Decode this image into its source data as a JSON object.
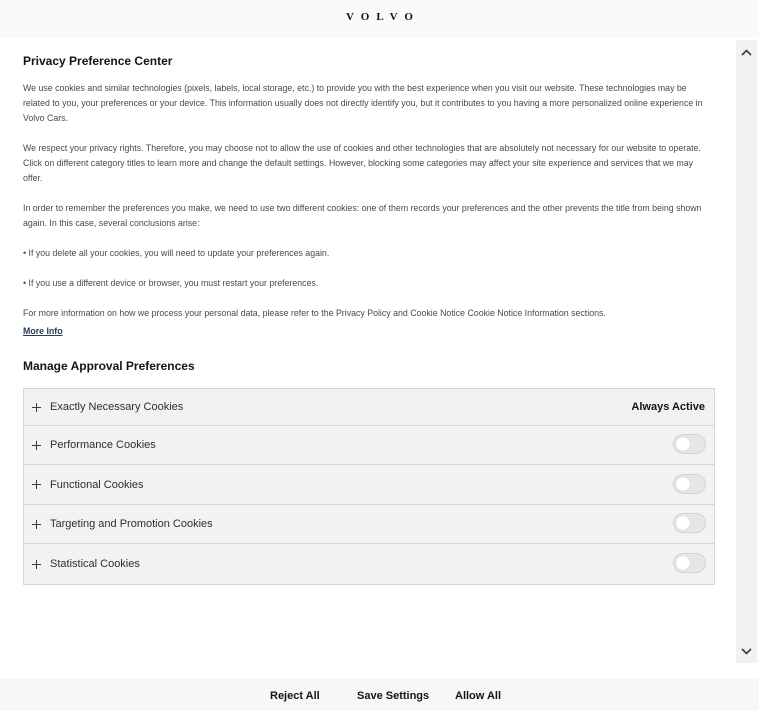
{
  "brand": {
    "logo_text": "VOLVO"
  },
  "dialog": {
    "title": "Privacy Preference Center",
    "paragraphs": [
      "We use cookies and similar technologies (pixels, labels, local storage, etc.) to provide you with the best experience when you visit our website. These technologies may be related to you, your preferences or your device. This information usually does not directly identify you, but it contributes to you having a more personalized online experience in Volvo Cars.",
      "We respect your privacy rights. Therefore, you may choose not to allow the use of cookies and other technologies that are absolutely not necessary for our website to operate. Click on different category titles to learn more and change the default settings. However, blocking some categories may affect your site experience and services that we may offer.",
      "In order to remember the preferences you make, we need to use two different cookies: one of them records your preferences and the other prevents the title from being shown again. In this case, several conclusions arise:",
      "• If you delete all your cookies, you will need to update your preferences again.",
      "• If you use a different device or browser, you must restart your preferences.",
      "For more information on how we process your personal data, please refer to the Privacy Policy and Cookie Notice Cookie Notice Information sections."
    ],
    "more_info_label": "More Info",
    "section_title": "Manage Approval Preferences",
    "categories": [
      {
        "label": "Exactly Necessary Cookies",
        "status": "Always Active"
      },
      {
        "label": "Performance Cookies",
        "enabled": false
      },
      {
        "label": "Functional Cookies",
        "enabled": false
      },
      {
        "label": "Targeting and Promotion Cookies",
        "enabled": false
      },
      {
        "label": "Statistical Cookies",
        "enabled": false
      }
    ]
  },
  "footer": {
    "reject_label": "Reject All",
    "save_label": "Save Settings",
    "allow_label": "Allow All"
  },
  "icons": {
    "expand": "plus-icon",
    "scroll_up": "chevron-up-icon",
    "scroll_down": "chevron-down-icon"
  }
}
